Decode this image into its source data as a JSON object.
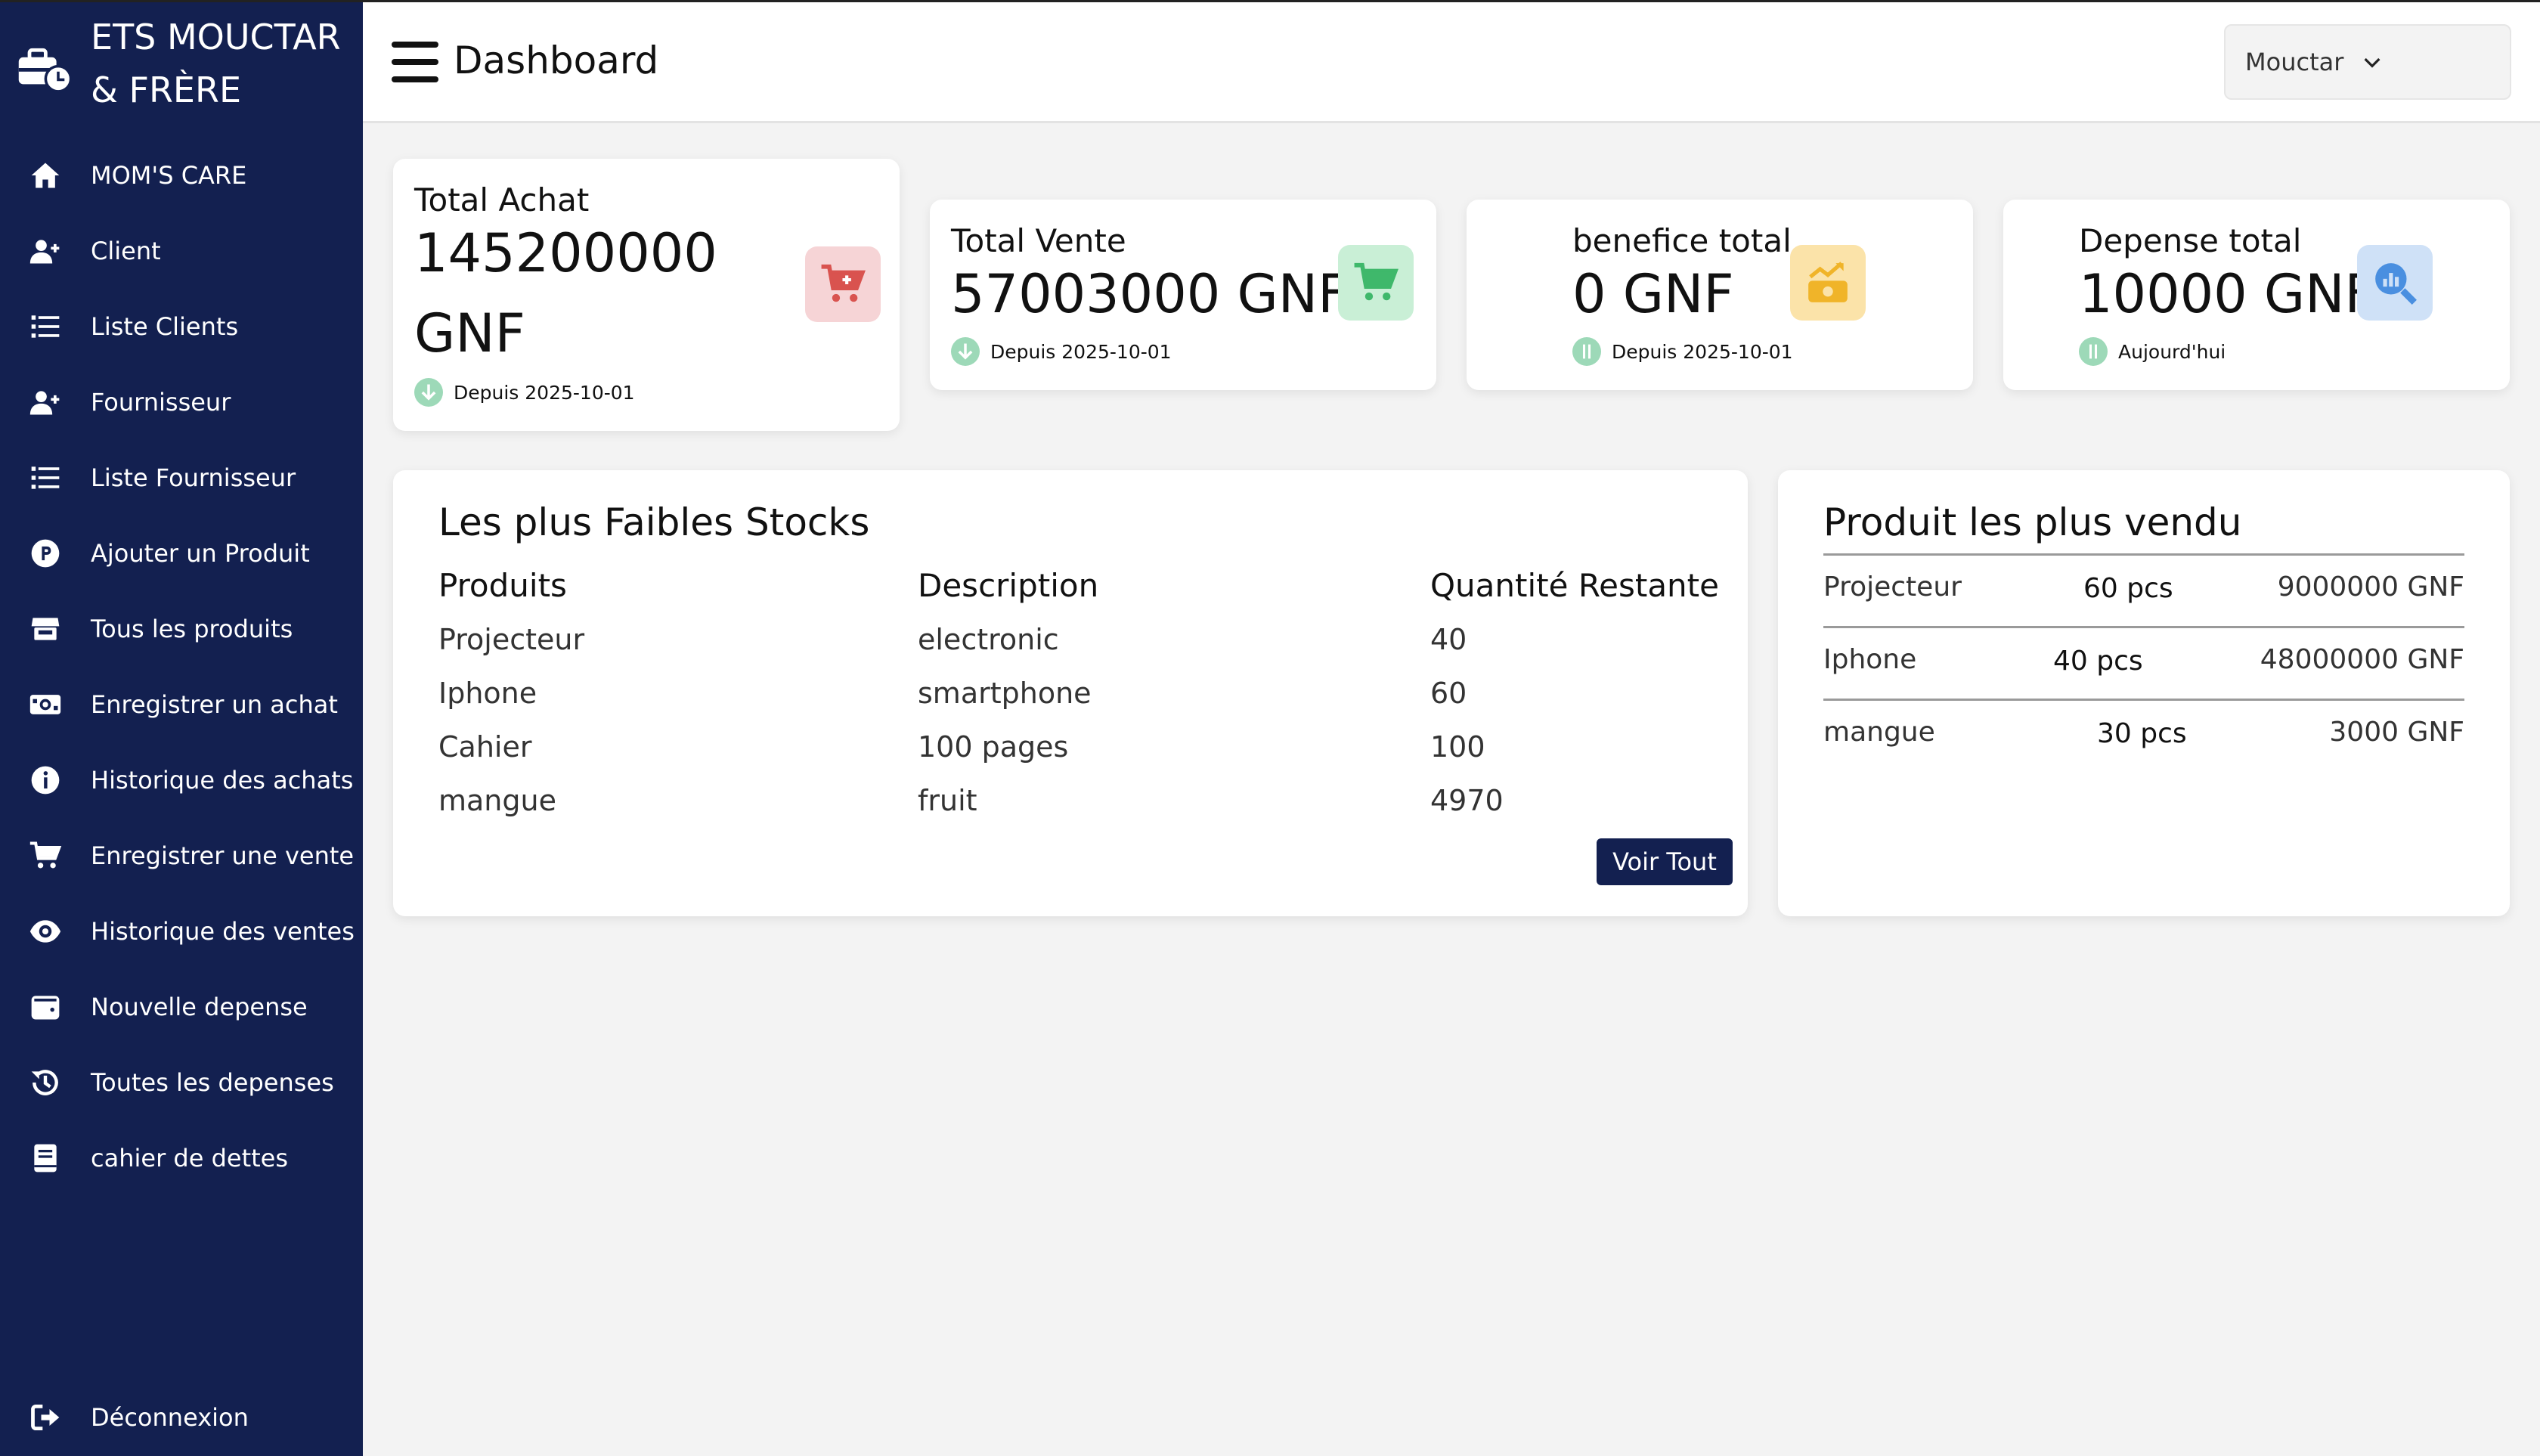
{
  "sidebar": {
    "brand_line1": "ETS MOUCTAR",
    "brand_line2": "& FRÈRE",
    "items": [
      {
        "label": "MOM'S CARE",
        "icon": "home-icon"
      },
      {
        "label": "Client",
        "icon": "user-plus-icon"
      },
      {
        "label": "Liste Clients",
        "icon": "list-icon"
      },
      {
        "label": "Fournisseur",
        "icon": "user-plus-icon"
      },
      {
        "label": "Liste Fournisseur",
        "icon": "list-icon"
      },
      {
        "label": "Ajouter un Produit",
        "icon": "product-icon"
      },
      {
        "label": "Tous les produits",
        "icon": "store-icon"
      },
      {
        "label": "Enregistrer un achat",
        "icon": "money-bill-icon"
      },
      {
        "label": "Historique des achats",
        "icon": "info-icon"
      },
      {
        "label": "Enregistrer une vente",
        "icon": "cart-icon"
      },
      {
        "label": "Historique des ventes",
        "icon": "eye-icon"
      },
      {
        "label": "Nouvelle depense",
        "icon": "wallet-icon"
      },
      {
        "label": "Toutes les depenses",
        "icon": "history-icon"
      },
      {
        "label": "cahier de dettes",
        "icon": "book-icon"
      }
    ],
    "logout_label": "Déconnexion"
  },
  "header": {
    "title": "Dashboard",
    "user": "Mouctar"
  },
  "stats": {
    "achat": {
      "title": "Total Achat",
      "value_line1": "145200000",
      "value_line2": "GNF",
      "foot": "Depuis 2025-10-01"
    },
    "vente": {
      "title": "Total Vente",
      "value": "57003000 GNF",
      "foot": "Depuis 2025-10-01"
    },
    "benefice": {
      "title": "benefice total",
      "value": "0 GNF",
      "foot": "Depuis 2025-10-01"
    },
    "depense": {
      "title": "Depense total",
      "value": "10000 GNF",
      "foot": "Aujourd'hui"
    }
  },
  "colors": {
    "sidebar_bg": "#132050",
    "achat_icon": "#d9534f",
    "vente_icon": "#3fb86b",
    "benefice_icon": "#f0b429",
    "depense_icon": "#4a8fe0"
  },
  "low_stock": {
    "title": "Les plus Faibles Stocks",
    "headers": {
      "produits": "Produits",
      "description": "Description",
      "quantite": "Quantité Restante"
    },
    "rows": [
      {
        "produit": "Projecteur",
        "description": "electronic",
        "quantite": "40"
      },
      {
        "produit": "Iphone",
        "description": "smartphone",
        "quantite": "60"
      },
      {
        "produit": "Cahier",
        "description": "100 pages",
        "quantite": "100"
      },
      {
        "produit": "mangue",
        "description": "fruit",
        "quantite": "4970"
      }
    ],
    "button_label": "Voir Tout"
  },
  "best_sellers": {
    "title": "Produit les plus vendu",
    "rows": [
      {
        "produit": "Projecteur",
        "qty": "60 pcs",
        "montant": "9000000 GNF"
      },
      {
        "produit": "Iphone",
        "qty": "40 pcs",
        "montant": "48000000 GNF"
      },
      {
        "produit": "mangue",
        "qty": "30 pcs",
        "montant": "3000 GNF"
      }
    ]
  }
}
